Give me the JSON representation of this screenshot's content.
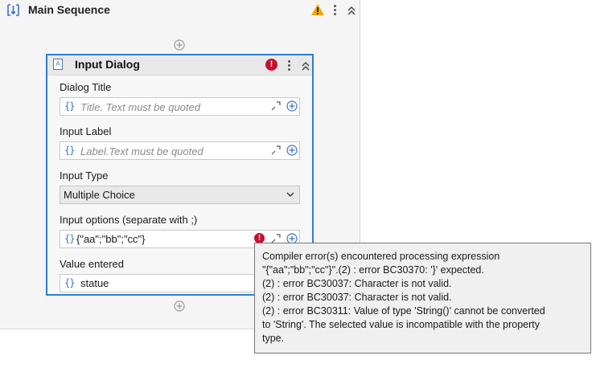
{
  "sequence": {
    "title": "Main Sequence"
  },
  "activity": {
    "title": "Input Dialog",
    "error_mark": "!",
    "icon_glyph": "A",
    "fields": {
      "dialog_title": {
        "label": "Dialog Title",
        "placeholder": "Title. Text must be quoted"
      },
      "input_label": {
        "label": "Input Label",
        "placeholder": "Label.Text must be quoted"
      },
      "input_type": {
        "label": "Input Type",
        "selected": "Multiple Choice"
      },
      "input_options": {
        "label": "Input options (separate with ;)",
        "value": "{\"aa\";\"bb\";\"cc\"}"
      },
      "value_entered": {
        "label": "Value entered",
        "value": "statue"
      }
    },
    "brace_glyph": "{}"
  },
  "tooltip": {
    "lines": [
      "Compiler error(s) encountered processing expression",
      "\"{\"aa\";\"bb\";\"cc\"}\".(2) : error BC30370: '}' expected.",
      "(2) : error BC30037: Character is not valid.",
      "(2) : error BC30037: Character is not valid.",
      "(2) : error BC30311: Value of type 'String()' cannot be converted",
      "to 'String'. The selected value is incompatible with the property",
      "type."
    ]
  },
  "icons": {
    "sequence": "sequence-icon",
    "warning": "warning-icon",
    "menu": "kebab-menu-icon",
    "collapse": "double-chevron-up-icon",
    "add": "plus-circle-icon",
    "expand": "expand-icon",
    "error": "error-icon",
    "dropdown": "chevron-down-icon"
  },
  "colors": {
    "accent": "#2d7dd2",
    "error": "#c8102e",
    "warning": "#f0a500",
    "brace": "#3b73c7"
  }
}
